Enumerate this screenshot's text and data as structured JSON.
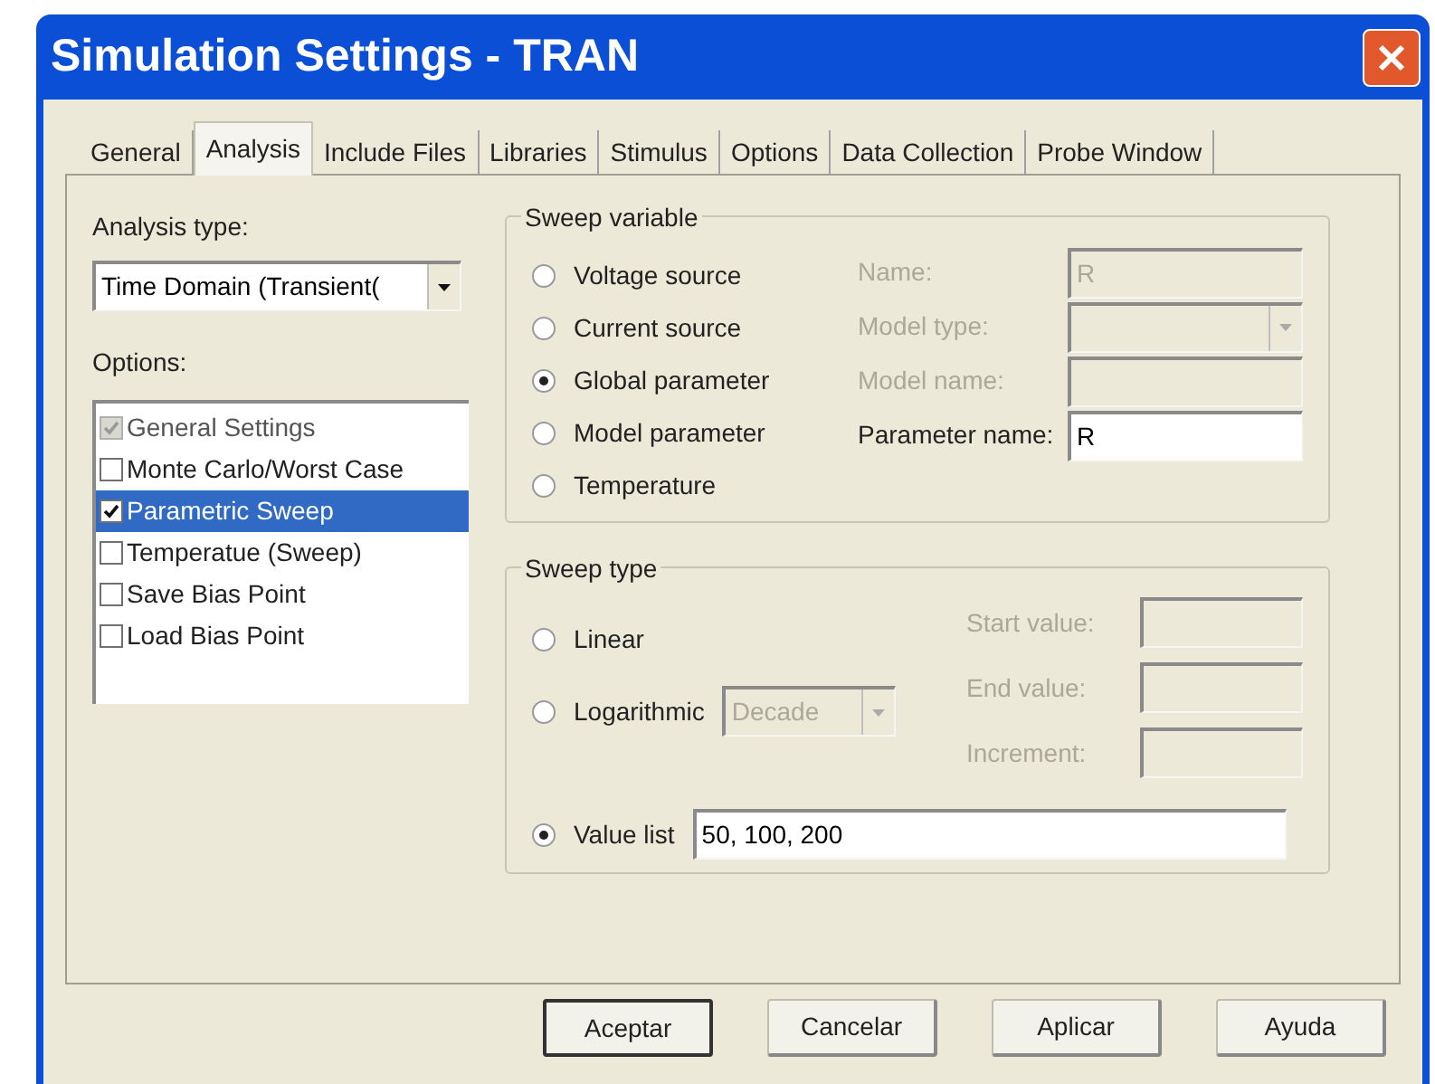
{
  "window": {
    "title": "Simulation Settings - TRAN"
  },
  "tabs": [
    {
      "label": "General",
      "selected": false
    },
    {
      "label": "Analysis",
      "selected": true
    },
    {
      "label": "Include Files",
      "selected": false
    },
    {
      "label": "Libraries",
      "selected": false
    },
    {
      "label": "Stimulus",
      "selected": false
    },
    {
      "label": "Options",
      "selected": false
    },
    {
      "label": "Data Collection",
      "selected": false
    },
    {
      "label": "Probe Window",
      "selected": false
    }
  ],
  "analysis_type": {
    "label": "Analysis type:",
    "value": "Time Domain (Transient("
  },
  "options": {
    "label": "Options:",
    "items": [
      {
        "label": "General Settings",
        "checked": true,
        "disabled": true,
        "selected": false
      },
      {
        "label": "Monte Carlo/Worst Case",
        "checked": false,
        "disabled": false,
        "selected": false
      },
      {
        "label": "Parametric Sweep",
        "checked": true,
        "disabled": false,
        "selected": true
      },
      {
        "label": "Temperatue (Sweep)",
        "checked": false,
        "disabled": false,
        "selected": false
      },
      {
        "label": "Save Bias Point",
        "checked": false,
        "disabled": false,
        "selected": false
      },
      {
        "label": "Load Bias Point",
        "checked": false,
        "disabled": false,
        "selected": false
      }
    ]
  },
  "sweep_variable": {
    "title": "Sweep variable",
    "choices": [
      {
        "label": "Voltage source",
        "selected": false
      },
      {
        "label": "Current source",
        "selected": false
      },
      {
        "label": "Global parameter",
        "selected": true
      },
      {
        "label": "Model parameter",
        "selected": false
      },
      {
        "label": "Temperature",
        "selected": false
      }
    ],
    "fields": [
      {
        "kind": "text",
        "label": "Name:",
        "value": "R",
        "disabled": true
      },
      {
        "kind": "dropdown",
        "label": "Model type:",
        "disabled": true
      },
      {
        "kind": "text",
        "label": "Model name:",
        "disabled": true
      },
      {
        "kind": "text",
        "label": "Parameter name:",
        "value": "R",
        "disabled": false
      }
    ]
  },
  "sweep_type": {
    "title": "Sweep type",
    "choices": [
      {
        "kind": "plain",
        "label": "Linear",
        "selected": false
      },
      {
        "kind": "dropdown",
        "label": "Logarithmic",
        "selected": false,
        "value": "Decade",
        "disabled": true
      },
      {
        "kind": "field",
        "label": "Value list",
        "selected": true,
        "value": "50, 100, 200"
      }
    ],
    "fields": [
      {
        "label": "Start value:",
        "disabled": true
      },
      {
        "label": "End value:",
        "disabled": true
      },
      {
        "label": "Increment:",
        "disabled": true
      }
    ]
  },
  "buttons": [
    {
      "label": "Aceptar",
      "default": true
    },
    {
      "label": "Cancelar",
      "default": false
    },
    {
      "label": "Aplicar",
      "default": false
    },
    {
      "label": "Ayuda",
      "default": false
    }
  ]
}
